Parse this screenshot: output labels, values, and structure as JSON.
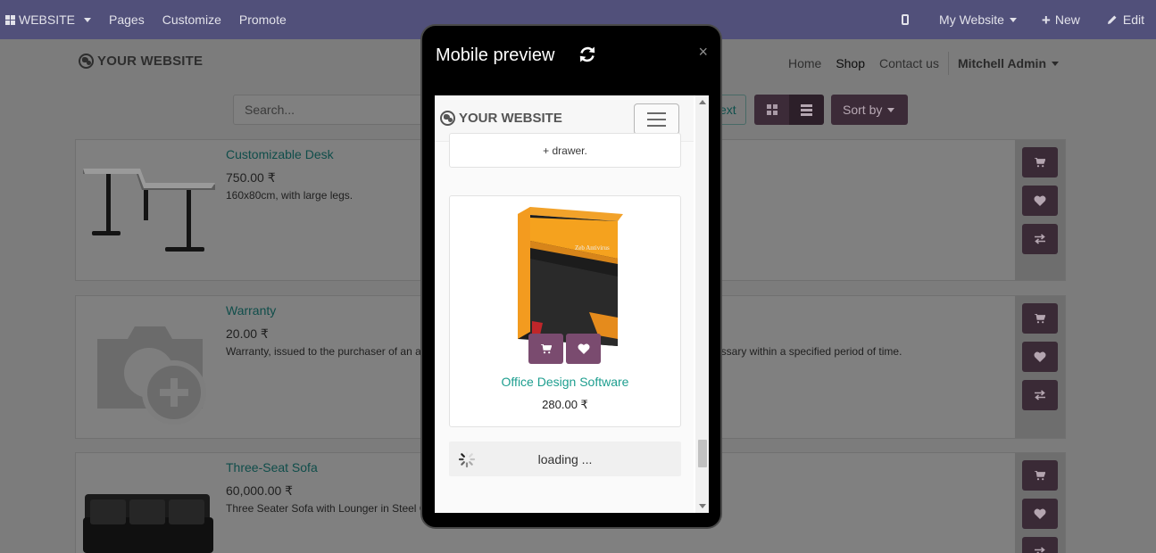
{
  "topbar": {
    "website_label": "WEBSITE",
    "pages_label": "Pages",
    "customize_label": "Customize",
    "promote_label": "Promote",
    "my_website_label": "My Website",
    "new_label": "New",
    "edit_label": "Edit"
  },
  "site": {
    "logo_text": "YOUR WEBSITE",
    "nav": {
      "home": "Home",
      "shop": "Shop",
      "contact": "Contact us",
      "user": "Mitchell Admin"
    },
    "search_placeholder": "Search...",
    "search_btn_tail": "ext",
    "sort_label": "Sort by"
  },
  "products": [
    {
      "name": "Customizable Desk",
      "price": "750.00 ₹",
      "description": "160x80cm, with large legs."
    },
    {
      "name": "Warranty",
      "price": "20.00 ₹",
      "description_left": "Warranty, issued to the purchaser of an a",
      "description_right": "essary within a specified period of time."
    },
    {
      "name": "Three-Seat Sofa",
      "price": "60,000.00 ₹",
      "description": "Three Seater Sofa with Lounger in Steel G"
    }
  ],
  "modal": {
    "title": "Mobile preview",
    "close": "×",
    "mobile": {
      "logo_text": "YOUR WEBSITE",
      "prev_card_text": "+ drawer.",
      "product": {
        "name": "Office Design Software",
        "price": "280.00 ₹",
        "box_text": "Zeb Antivirus"
      },
      "loading_text": "loading ..."
    }
  },
  "icons": {
    "cart": "cart-icon",
    "heart": "heart-icon",
    "compare": "exchange-icon",
    "refresh": "refresh-icon",
    "spinner": "spinner-icon"
  },
  "colors": {
    "topbar": "#51507a",
    "accent_btn": "#7a4b6f",
    "link_teal": "#1e9e8f"
  }
}
